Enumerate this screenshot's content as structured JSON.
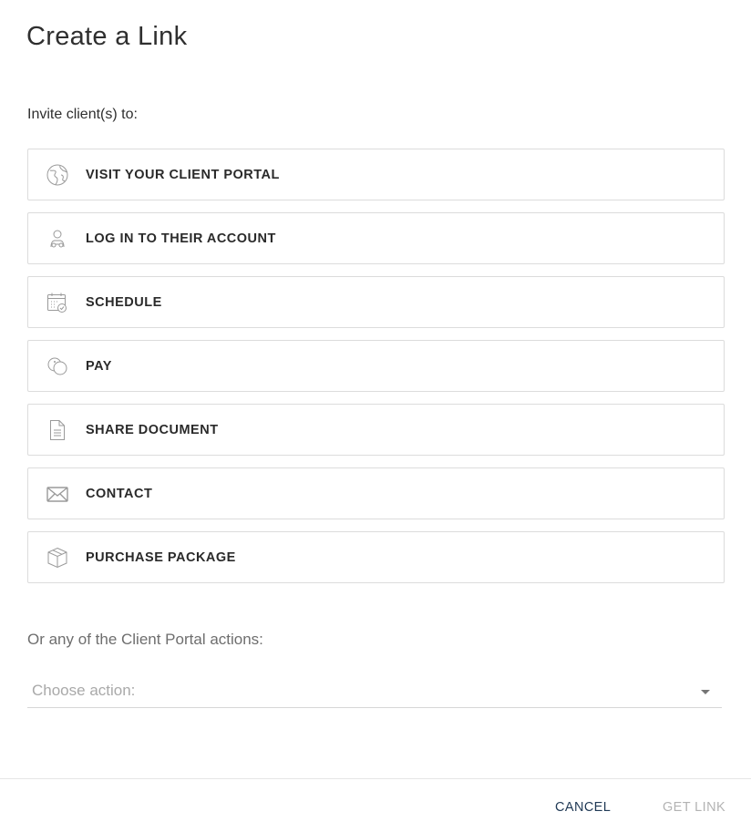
{
  "dialog": {
    "title": "Create a Link",
    "subtitle": "Invite client(s) to:"
  },
  "options": [
    {
      "label": "VISIT YOUR CLIENT PORTAL",
      "icon": "globe-icon"
    },
    {
      "label": "LOG IN TO THEIR ACCOUNT",
      "icon": "user-icon"
    },
    {
      "label": "SCHEDULE",
      "icon": "calendar-check-icon"
    },
    {
      "label": "PAY",
      "icon": "coins-icon"
    },
    {
      "label": "SHARE DOCUMENT",
      "icon": "document-icon"
    },
    {
      "label": "CONTACT",
      "icon": "envelope-icon"
    },
    {
      "label": "PURCHASE PACKAGE",
      "icon": "package-box-icon"
    }
  ],
  "portal_actions": {
    "label": "Or any of the Client Portal actions:",
    "select_placeholder": "Choose action:"
  },
  "footer": {
    "cancel_label": "CANCEL",
    "get_link_label": "GET LINK"
  },
  "colors": {
    "icon_stroke": "#9a9a9a",
    "border": "#dcdcdc",
    "cancel": "#213a56",
    "disabled": "#b3b3b3"
  }
}
